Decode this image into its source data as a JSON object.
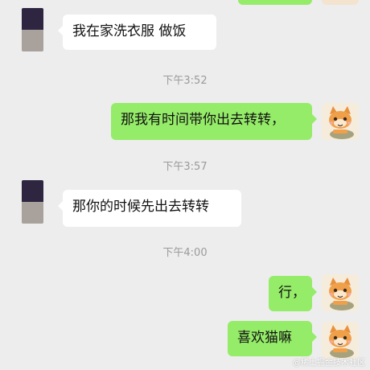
{
  "messages": [
    {
      "side": "in",
      "text": "我在家洗衣服 做饭"
    },
    {
      "time": "下午3:52"
    },
    {
      "side": "out",
      "text": "那我有时间带你出去转转，"
    },
    {
      "time": "下午3:57"
    },
    {
      "side": "in",
      "text": "那你的时候先出去转转"
    },
    {
      "time": "下午4:00"
    },
    {
      "side": "out",
      "text": "行，"
    },
    {
      "side": "out",
      "text": "喜欢猫嘛"
    }
  ],
  "watermark": "@稀土掘金技术社区",
  "avatar_right_icon": "cartoon-cat-avatar",
  "colors": {
    "background": "#ededed",
    "outgoing_bubble": "#95ec69",
    "incoming_bubble": "#ffffff",
    "timestamp": "#9a9a9a"
  }
}
